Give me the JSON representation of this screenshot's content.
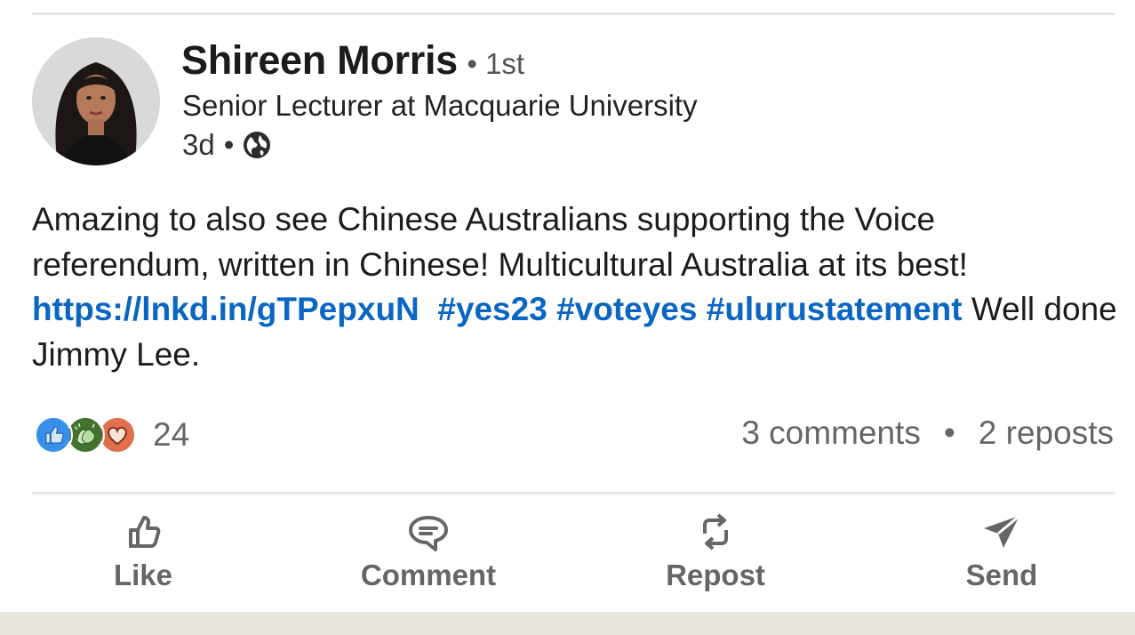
{
  "author": {
    "name": "Shireen Morris",
    "degree": "• 1st",
    "headline": "Senior Lecturer at Macquarie University",
    "time": "3d",
    "time_sep": "•"
  },
  "post": {
    "text_part1": "Amazing to also see Chinese Australians supporting the Voice referendum, written in Chinese! Multicultural Australia at its best! ",
    "link": "https://lnkd.in/gTPepxuN",
    "hashtag1": "#yes23",
    "hashtag2": "#voteyes",
    "hashtag3": "#ulurustatement",
    "text_part2": " Well done Jimmy Lee."
  },
  "social": {
    "reaction_count": "24",
    "comments": "3 comments",
    "separator": "•",
    "reposts": "2 reposts",
    "reaction_icons": [
      "like-icon",
      "celebrate-icon",
      "love-icon"
    ]
  },
  "actions": {
    "like": "Like",
    "comment": "Comment",
    "repost": "Repost",
    "send": "Send"
  },
  "colors": {
    "link": "#0a66c2",
    "like_blue": "#378fe9",
    "celebrate_green": "#44712e",
    "love_orange": "#df704d"
  }
}
